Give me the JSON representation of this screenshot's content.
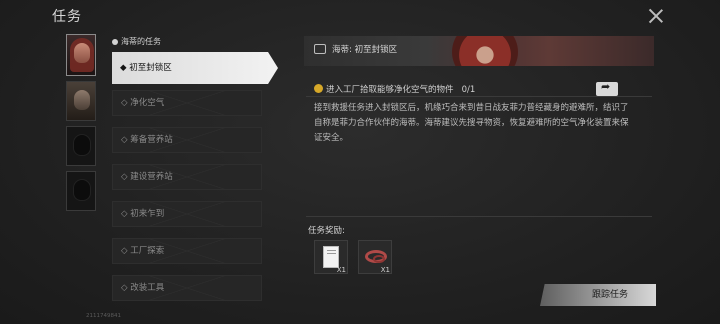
{
  "header": {
    "title": "任务"
  },
  "list": {
    "header": "海蒂的任务",
    "tasks": [
      {
        "label": "◆ 初至封锁区",
        "active": true
      },
      {
        "label": "◇ 净化空气"
      },
      {
        "label": "◇ 筹备营养站"
      },
      {
        "label": "◇ 建设营养站"
      },
      {
        "label": "◇ 初来乍到"
      },
      {
        "label": "◇ 工厂探索"
      },
      {
        "label": "◇ 改装工具"
      }
    ]
  },
  "detail": {
    "banner_label": "海蒂: 初至封锁区",
    "objective": "进入工厂拾取能够净化空气的物件",
    "progress": "0/1",
    "description": "接到救援任务进入封锁区后，机缘巧合来到昔日战友菲力普经藏身的避难所，结识了自称是菲力合作伙伴的海蒂。海蒂建议先搜寻物资，恢复避难所的空气净化装置来保证安全。"
  },
  "rewards": {
    "title": "任务奖励:",
    "items": [
      {
        "icon": "paper-icon",
        "count": "X1"
      },
      {
        "icon": "rope-icon",
        "count": "X1"
      }
    ]
  },
  "track_button": "跟踪任务",
  "uid": "2111749841",
  "colors": {
    "accent_warning": "#d6a829",
    "active_tab": "#e6e6e6",
    "reward_rope": "#b04a48"
  }
}
